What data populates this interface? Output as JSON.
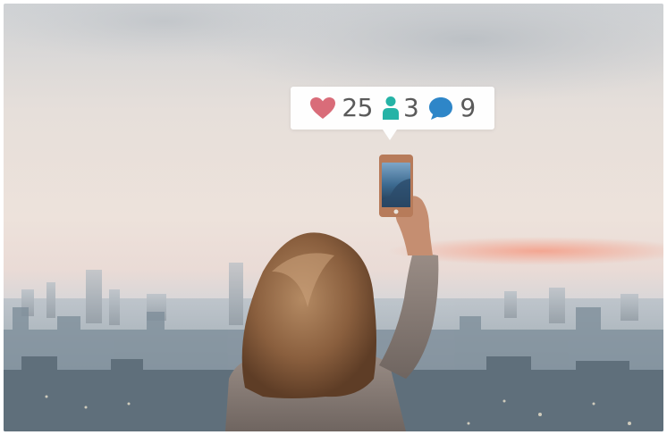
{
  "notification": {
    "likes": {
      "icon": "heart-icon",
      "count": "25",
      "color": "#d96c79"
    },
    "followers": {
      "icon": "person-icon",
      "count": "3",
      "color": "#25b3a6"
    },
    "comments": {
      "icon": "speech-bubble-icon",
      "count": "9",
      "color": "#2e86c8"
    }
  },
  "colors": {
    "sky_top": "#c9ccd0",
    "sky_mid": "#ede3dc",
    "haze": "#b8c4cc",
    "sunset_glow": "#f0a28e",
    "city": "#8a9aa6"
  }
}
